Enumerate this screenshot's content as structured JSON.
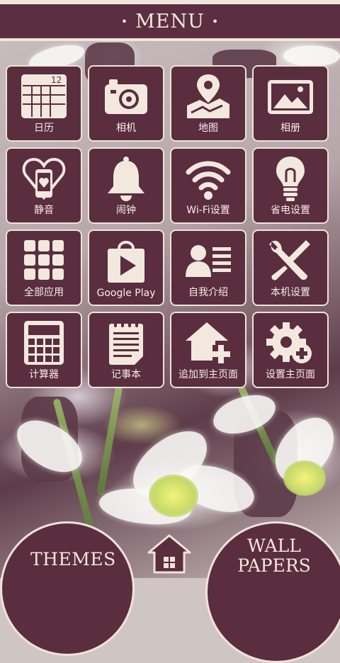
{
  "header": {
    "title": "MENU",
    "dot": "•"
  },
  "tiles": [
    {
      "label": "日历",
      "icon": "calendar-icon",
      "badge": "12"
    },
    {
      "label": "相机",
      "icon": "camera-icon"
    },
    {
      "label": "地图",
      "icon": "map-icon"
    },
    {
      "label": "相册",
      "icon": "gallery-icon"
    },
    {
      "label": "静音",
      "icon": "silent-phone-heart-icon"
    },
    {
      "label": "闹钟",
      "icon": "bell-icon"
    },
    {
      "label": "Wi-Fi设置",
      "icon": "wifi-icon"
    },
    {
      "label": "省电设置",
      "icon": "lightbulb-icon"
    },
    {
      "label": "全部应用",
      "icon": "apps-grid-icon"
    },
    {
      "label": "Google Play",
      "icon": "play-store-icon"
    },
    {
      "label": "自我介绍",
      "icon": "profile-icon"
    },
    {
      "label": "本机设置",
      "icon": "tools-icon"
    },
    {
      "label": "计算器",
      "icon": "calculator-icon"
    },
    {
      "label": "记事本",
      "icon": "notepad-icon"
    },
    {
      "label": "追加到主页面",
      "icon": "add-home-icon"
    },
    {
      "label": "设置主页面",
      "icon": "gear-plus-icon"
    }
  ],
  "bottom": {
    "themes_label": "THEMES",
    "wallpapers_line1": "WALL",
    "wallpapers_line2": "PAPERS",
    "home_icon": "home-icon"
  },
  "colors": {
    "tile_bg": "#5a2d3f",
    "border": "#efe3d8",
    "text": "#f5ebe1"
  }
}
